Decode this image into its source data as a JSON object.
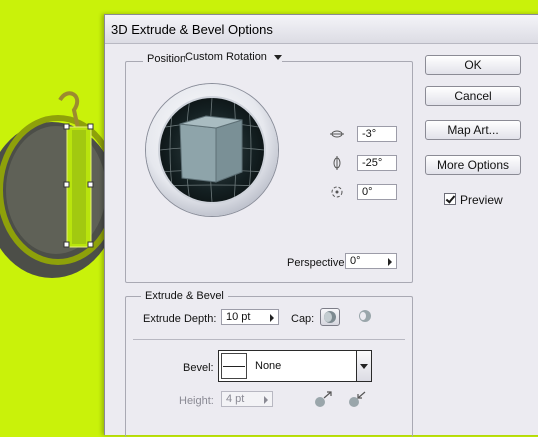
{
  "dialog": {
    "title": "3D Extrude & Bevel Options"
  },
  "position": {
    "label": "Position:",
    "preset": "Custom Rotation",
    "x_rotation": "-3°",
    "y_rotation": "-25°",
    "z_rotation": "0°",
    "perspective_label": "Perspective:",
    "perspective_value": "0°"
  },
  "buttons": {
    "ok": "OK",
    "cancel": "Cancel",
    "map_art": "Map Art...",
    "more_options": "More Options"
  },
  "preview": {
    "label": "Preview",
    "checked": true
  },
  "extrude": {
    "section_label": "Extrude & Bevel",
    "depth_label": "Extrude Depth:",
    "depth_value": "10 pt",
    "cap_label": "Cap:",
    "bevel_label": "Bevel:",
    "bevel_value": "None",
    "height_label": "Height:",
    "height_value": "4 pt"
  },
  "icons": {
    "x_axis": "rotate-x-icon",
    "y_axis": "rotate-y-icon",
    "z_axis": "rotate-z-icon",
    "cap_on": "cap-on-icon",
    "cap_off": "cap-off-icon",
    "bevel_out": "bevel-extent-out-icon",
    "bevel_in": "bevel-extent-in-icon"
  },
  "colors": {
    "background_art": "#c9f20a",
    "cube": "#8ea4aa",
    "dialog": "#ecebf1"
  }
}
